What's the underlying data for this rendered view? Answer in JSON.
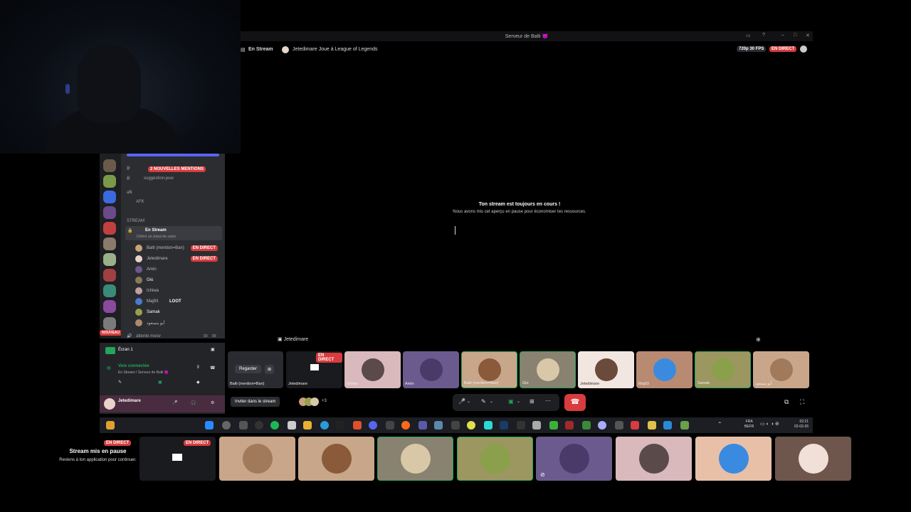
{
  "window": {
    "title": "Serveur de Balti 😈"
  },
  "stream_header": {
    "channel": "En Stream",
    "activity": "Jetedimare Joue à League of Legends",
    "quality": "720p 30 FPS",
    "live": "EN DIRECT"
  },
  "stream_paused": {
    "title": "Ton stream est toujours en cours !",
    "subtitle": "Nous avons mis cet aperçu en pause pour économiser tes ressources."
  },
  "sidebar": {
    "mentions_badge": "2 NOUVELLES MENTIONS",
    "channels": [
      {
        "label": "suggestion-jeux"
      },
      {
        "label": "afk"
      },
      {
        "label": "AFK"
      }
    ],
    "section_stream": "STREAM",
    "voice_channel": {
      "name": "En Stream",
      "status": "Définir un statut de salon"
    },
    "members": [
      {
        "name": "Balti (mention=Ban)",
        "live": "EN DIRECT",
        "color": "#c8a27a"
      },
      {
        "name": "Jetedimare",
        "live": "EN DIRECT",
        "color": "#e8d4c8"
      },
      {
        "name": "Amin",
        "live": "",
        "color": "#6a5a8a"
      },
      {
        "name": "Gio",
        "live": "",
        "color": "#8a7a5a"
      },
      {
        "name": "Ichiwa",
        "live": "",
        "color": "#c0a0a0"
      },
      {
        "name": "Maj93",
        "live": "",
        "color": "#4a7acc"
      },
      {
        "name": "Samak",
        "live": "",
        "color": "#9aa04a"
      },
      {
        "name": "أبو مسعود",
        "live": "",
        "color": "#b08a6a"
      }
    ],
    "loot_tag": "LOOT",
    "new_label": "NOUVEAU",
    "attente": "attente moov",
    "attente_count": "00",
    "attente_total": "99"
  },
  "user_panel": {
    "screen": "Écran 1",
    "voice_status": "Voix connectée",
    "voice_location": "En Stream / Serveur de Balti 😈",
    "username": "Jetedimare"
  },
  "stage": {
    "streamer": "Jetedimare",
    "watch_button": "Regarder",
    "invite_button": "Inviter dans le stream",
    "participants_more": "+3",
    "tiles": [
      {
        "label": "Balti (mention=Ban)",
        "bg": "#2a2b30",
        "type": "watch"
      },
      {
        "label": "Jetedimare",
        "bg": "#1a1b1e",
        "type": "stream",
        "live": "EN DIRECT"
      },
      {
        "label": "Ichiwa",
        "bg": "#d9b9bb",
        "type": "avatar",
        "color": "#5a4a4a"
      },
      {
        "label": "Amin",
        "bg": "#6b5a8e",
        "type": "avatar",
        "color": "#4a3a6a"
      },
      {
        "label": "Balti (mention=Ban)",
        "bg": "#c7a689",
        "type": "avatar",
        "color": "#8a5a3a"
      },
      {
        "label": "Gio",
        "bg": "#8a8270",
        "type": "avatar",
        "color": "#d8c8a8"
      },
      {
        "label": "Jetedimare",
        "bg": "#f2e6e0",
        "type": "avatar",
        "color": "#6a4a3a"
      },
      {
        "label": "Maj93",
        "bg": "#b98a72",
        "type": "avatar",
        "color": "#3a8ae0"
      },
      {
        "label": "Samak",
        "bg": "#9c9660",
        "type": "avatar",
        "color": "#8aa04a"
      },
      {
        "label": "أبو مسعود",
        "bg": "#c9a68a",
        "type": "avatar",
        "color": "#a07a5a"
      }
    ]
  },
  "taskbar": {
    "lang": "FRA",
    "locale": "BEFR",
    "time": "02:21",
    "date": "02-03-26"
  },
  "bottom": {
    "live": "EN DIRECT",
    "pause_title": "Stream mis en pause",
    "pause_sub": "Reviens à ton application pour continuer.",
    "live2": "EN DIRECT",
    "tiles": [
      {
        "bg": "#c9a68a",
        "color": "#a07a5a"
      },
      {
        "bg": "#c7a689",
        "color": "#8a5a3a"
      },
      {
        "bg": "#8a8270",
        "color": "#d8c8a8"
      },
      {
        "bg": "#9c9660",
        "color": "#8aa04a"
      },
      {
        "bg": "#6b5a8e",
        "color": "#4a3a6a"
      },
      {
        "bg": "#d9b9bb",
        "color": "#5a4a4a"
      },
      {
        "bg": "#e8c0a8",
        "color": "#3a8ae0"
      },
      {
        "bg": "#6e564c",
        "color": "#f0e0d8"
      }
    ]
  }
}
